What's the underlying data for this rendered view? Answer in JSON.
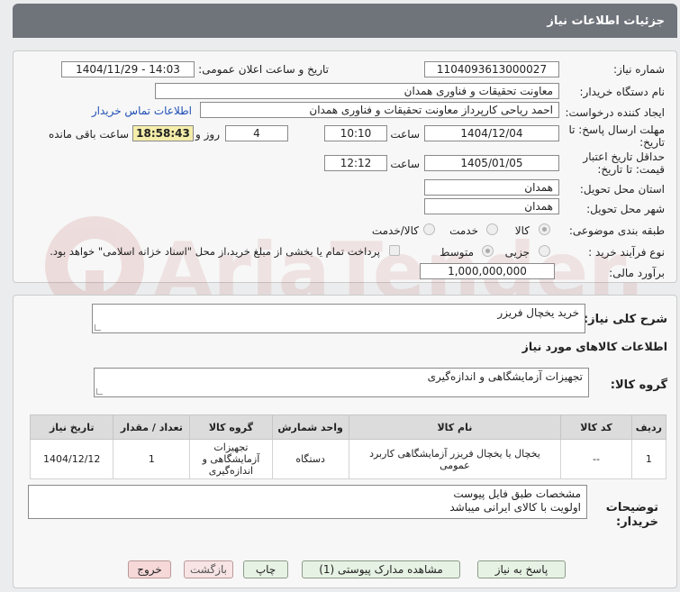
{
  "header": {
    "title": "جزئیات اطلاعات نیاز"
  },
  "form": {
    "need_number_label": "شماره نیاز:",
    "need_number": "1104093613000027",
    "announce_label": "تاریخ و ساعت اعلان عمومی:",
    "announce_value": "1404/11/29 - 14:03",
    "buyer_org_label": "نام دستگاه خریدار:",
    "buyer_org": "معاونت تحقیقات و فناوری همدان",
    "creator_label": "ایجاد کننده درخواست:",
    "creator": "احمد ریاحی کارپرداز معاونت تحقیقات و فناوری همدان",
    "contact_link": "اطلاعات تماس خریدار",
    "reply_deadline_label": "مهلت ارسال پاسخ: تا تاریخ:",
    "reply_date": "1404/12/04",
    "time_label": "ساعت",
    "reply_time": "10:10",
    "days": "4",
    "days_and_label": "روز و",
    "remaining_time": "18:58:43",
    "remaining_label": "ساعت باقی مانده",
    "price_validity_label": "حداقل تاریخ اعتبار قیمت: تا تاریخ:",
    "validity_date": "1405/01/05",
    "validity_time": "12:12",
    "province_label": "استان محل تحویل:",
    "province": "همدان",
    "city_label": "شهر محل تحویل:",
    "city": "همدان",
    "category_label": "طبقه بندی موضوعی:",
    "category_options": [
      "کالا",
      "خدمت",
      "کالا/خدمت"
    ],
    "process_label": "نوع فرآیند خرید :",
    "process_options": [
      "جزیی",
      "متوسط"
    ],
    "payment_note": "پرداخت تمام یا بخشی از مبلغ خرید،از محل \"اسناد خزانه اسلامی\" خواهد بود.",
    "estimate_label": "برآورد مالی:",
    "estimate": "1,000,000,000"
  },
  "summary": {
    "label": "شرح کلی نیاز:",
    "value": "خرید یخچال فریزر"
  },
  "goods": {
    "section_title": "اطلاعات کالاهای مورد نیاز",
    "group_label": "گروه کالا:",
    "group_value": "تجهیزات آزمایشگاهی و اندازه‌گیری"
  },
  "table": {
    "headers": [
      "ردیف",
      "کد کالا",
      "نام کالا",
      "واحد شمارش",
      "گروه کالا",
      "تعداد / مقدار",
      "تاریخ نیاز"
    ],
    "rows": [
      [
        "1",
        "--",
        "یخچال یا یخچال فریزر آزمایشگاهی کاربرد عمومی",
        "دستگاه",
        "تجهیزات آزمایشگاهی و اندازه‌گیری",
        "1",
        "1404/12/12"
      ]
    ]
  },
  "notes": {
    "label": "توضیحات خریدار:",
    "line1": "مشخصات طبق فایل پیوست",
    "line2": "اولویت با کالای ایرانی میباشد"
  },
  "buttons": {
    "reply": "پاسخ به نیاز",
    "attachments": "مشاهده مدارک پیوستی (1)",
    "print": "چاپ",
    "back": "بازگشت",
    "exit": "خروج"
  },
  "watermark": {
    "text": "AriaTender.net"
  }
}
